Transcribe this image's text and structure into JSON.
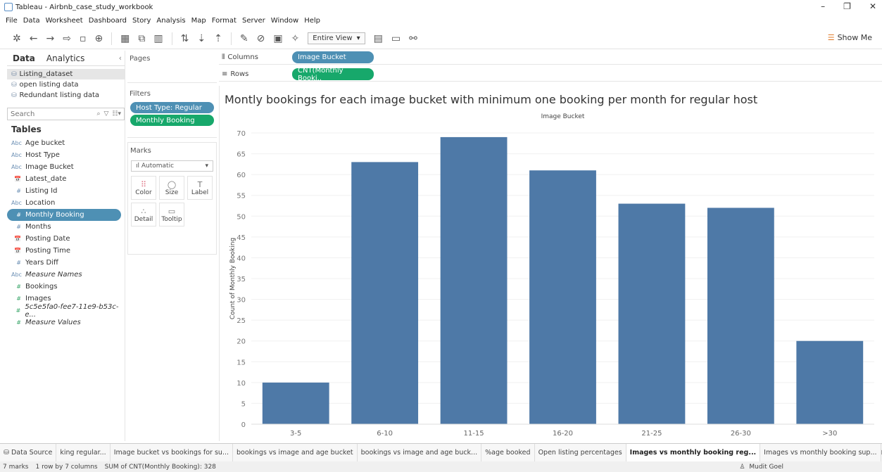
{
  "window": {
    "title": "Tableau - Airbnb_case_study_workbook",
    "controls": [
      "–",
      "❐",
      "✕"
    ]
  },
  "menu": [
    "File",
    "Data",
    "Worksheet",
    "Dashboard",
    "Story",
    "Analysis",
    "Map",
    "Format",
    "Server",
    "Window",
    "Help"
  ],
  "toolbar": {
    "view_select": "Entire View",
    "show_me": "Show Me"
  },
  "data_pane": {
    "tabs": [
      "Data",
      "Analytics"
    ],
    "data_sources": [
      "Listing_dataset",
      "open listing data",
      "Redundant listing data"
    ],
    "search_placeholder": "Search",
    "tables_title": "Tables",
    "fields": [
      {
        "type": "Abc",
        "label": "Age bucket",
        "kind": "dim"
      },
      {
        "type": "Abc",
        "label": "Host Type",
        "kind": "dim"
      },
      {
        "type": "Abc",
        "label": "Image Bucket",
        "kind": "dim"
      },
      {
        "type": "📅",
        "label": "Latest_date",
        "kind": "dim"
      },
      {
        "type": "#",
        "label": "Listing Id",
        "kind": "dim"
      },
      {
        "type": "Abc",
        "label": "Location",
        "kind": "dim"
      },
      {
        "type": "#",
        "label": "Monthly Booking",
        "kind": "highlight"
      },
      {
        "type": "#",
        "label": "Months",
        "kind": "dim"
      },
      {
        "type": "📅",
        "label": "Posting Date",
        "kind": "dim"
      },
      {
        "type": "📅",
        "label": "Posting Time",
        "kind": "dim"
      },
      {
        "type": "#",
        "label": "Years Diff",
        "kind": "dim"
      },
      {
        "type": "Abc",
        "label": "Measure Names",
        "kind": "italic"
      },
      {
        "type": "#",
        "label": "Bookings",
        "kind": "measure"
      },
      {
        "type": "#",
        "label": "Images",
        "kind": "measure"
      },
      {
        "type": "#",
        "label": "5c5e5fa0-fee7-11e9-b53c-e...",
        "kind": "measure-italic"
      },
      {
        "type": "#",
        "label": "Measure Values",
        "kind": "measure-italic"
      }
    ]
  },
  "cards": {
    "pages_title": "Pages",
    "filters_title": "Filters",
    "filters": [
      "Host Type: Regular",
      "Monthly Booking"
    ],
    "marks_title": "Marks",
    "marks_type": "Automatic",
    "marks_buttons": [
      {
        "icon": "⠿",
        "label": "Color"
      },
      {
        "icon": "◯",
        "label": "Size"
      },
      {
        "icon": "T",
        "label": "Label"
      },
      {
        "icon": "∴",
        "label": "Detail"
      },
      {
        "icon": "▭",
        "label": "Tooltip"
      }
    ]
  },
  "shelves": {
    "columns_label": "Columns",
    "columns_pill": "Image Bucket",
    "rows_label": "Rows",
    "rows_pill": "CNT(Monthly Booki.."
  },
  "chart_data": {
    "type": "bar",
    "title": "Montly bookings for each image bucket with minimum one booking per month for regular host",
    "xlabel": "Image Bucket",
    "ylabel": "Count of Monthly Booking",
    "categories": [
      "3-5",
      "6-10",
      "11-15",
      "16-20",
      "21-25",
      "26-30",
      ">30"
    ],
    "values": [
      10,
      63,
      69,
      61,
      53,
      52,
      20
    ],
    "ylim": [
      0,
      70
    ],
    "yticks": [
      0,
      5,
      10,
      15,
      20,
      25,
      30,
      35,
      40,
      45,
      50,
      55,
      60,
      65,
      70
    ],
    "bar_color": "#4e79a7",
    "grid": true
  },
  "sheet_tabs": {
    "data_source": "Data Source",
    "tabs": [
      "king regular...",
      "Image bucket vs bookings for su...",
      "bookings vs image and age bucket",
      "bookings vs image and age buck...",
      "%age booked",
      "Open listing percentages",
      "Images vs monthly booking reg...",
      "Images vs monthly booking sup..."
    ],
    "active_index": 6
  },
  "status": {
    "marks": "7 marks",
    "dims": "1 row by 7 columns",
    "sum": "SUM of CNT(Monthly Booking): 328",
    "user": "Mudit Goel"
  }
}
